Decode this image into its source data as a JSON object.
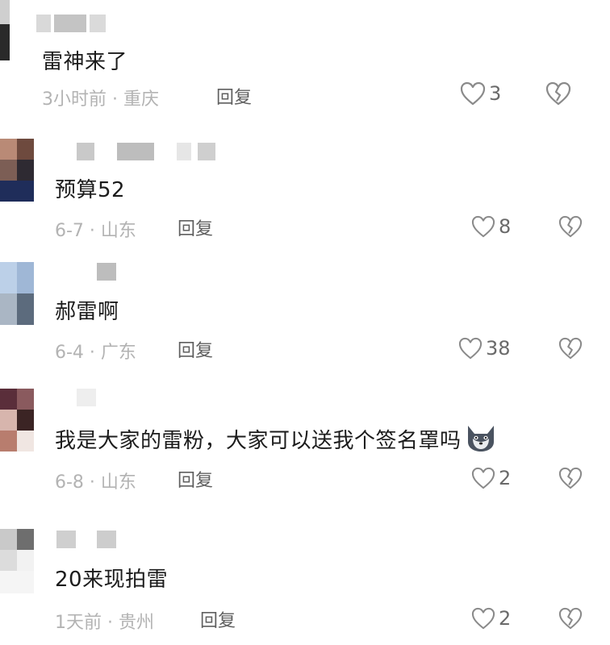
{
  "comments": [
    {
      "text": "雷神来了",
      "meta": "3小时前 · 重庆",
      "reply_label": "回复",
      "likes": "3"
    },
    {
      "text": "预算52",
      "meta": "6-7 · 山东",
      "reply_label": "回复",
      "likes": "8"
    },
    {
      "text": "郝雷啊",
      "meta": "6-4 · 广东",
      "reply_label": "回复",
      "likes": "38"
    },
    {
      "text": "我是大家的雷粉，大家可以送我个签名罩吗",
      "meta": "6-8 · 山东",
      "reply_label": "回复",
      "likes": "2",
      "emoji": "wolf-face-emoji"
    },
    {
      "text": "20来现拍雷",
      "meta": "1天前 · 贵州",
      "reply_label": "回复",
      "likes": "2"
    }
  ],
  "icons": {
    "like": "heart-outline-icon",
    "dislike": "broken-heart-icon"
  },
  "colors": {
    "text": "#1c1c1c",
    "meta": "#b3b3b3",
    "reply": "#5f5f5f",
    "icon": "#8a8a8a"
  }
}
